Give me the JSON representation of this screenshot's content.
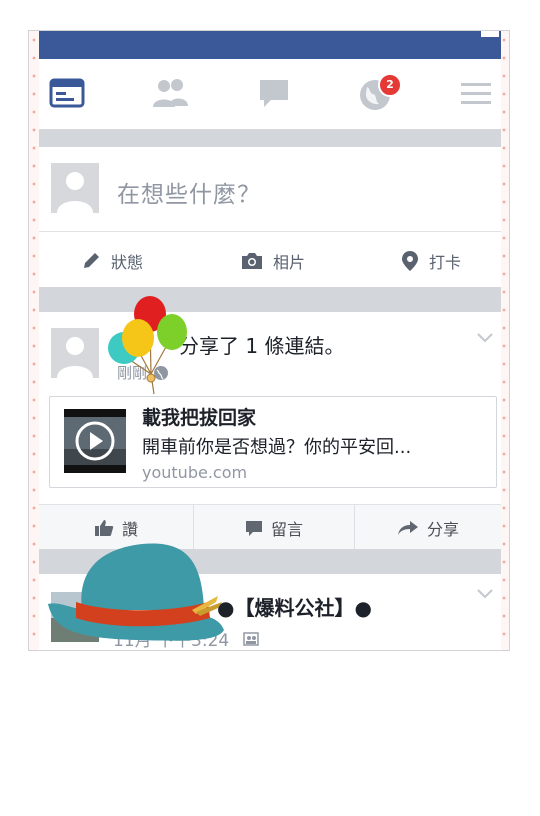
{
  "nav": {
    "icons": [
      "news-feed-icon",
      "friend-requests-icon",
      "messages-icon",
      "notifications-globe-icon",
      "menu-icon"
    ],
    "notification_count": "2",
    "active_color": "#3b5998"
  },
  "composer": {
    "placeholder": "在想些什麼？",
    "actions": [
      {
        "label": "狀態",
        "icon": "pencil-icon"
      },
      {
        "label": "相片",
        "icon": "camera-icon"
      },
      {
        "label": "打卡",
        "icon": "location-pin-icon"
      }
    ]
  },
  "post": {
    "header": "分享了 1 條連結。",
    "meta": "剛剛",
    "link": {
      "title": "載我把拔回家",
      "description": "開車前你是否想過？你的平安回...",
      "domain": "youtube.com"
    },
    "actions": {
      "like": "讚",
      "comment": "留言",
      "share": "分享"
    }
  },
  "post2": {
    "header": "●【爆料公社】●",
    "meta": "11月  下午3:24"
  },
  "colors": {
    "brand": "#3b5998",
    "badge": "#e53935",
    "frame_dots": "#f0a8a0"
  }
}
